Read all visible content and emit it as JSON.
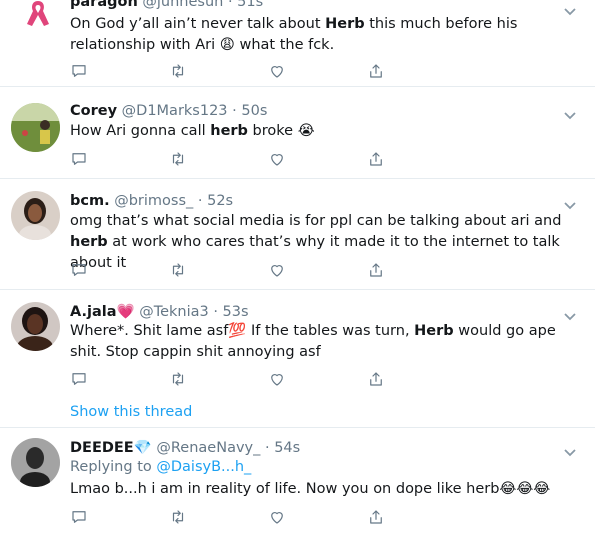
{
  "tweets": [
    {
      "name": "paragon",
      "handle": "@junnesun",
      "time": "· 51s",
      "text_parts": [
        "On God y’all ain’t never talk about ",
        "Herb",
        " this much before his relationship with Ari ",
        "😩",
        " what the fck."
      ]
    },
    {
      "name": "Corey",
      "handle": "@D1Marks123",
      "time": "· 50s",
      "text_parts": [
        "How Ari gonna call ",
        "herb",
        " broke ",
        "😭"
      ]
    },
    {
      "name": "bcm.",
      "handle": "@brimoss_",
      "time": "· 52s",
      "text_parts": [
        "omg that’s what social media is for ppl can be talking about ari and ",
        "herb",
        " at work who cares that’s why it made it to the internet to talk about it"
      ]
    },
    {
      "name": "A.jala",
      "name_emoji": "💗",
      "handle": "@Teknia3",
      "time": "· 53s",
      "text_parts": [
        "Where*. Shit lame asf",
        "💯",
        " If the tables was turn, ",
        "Herb",
        " would go ape shit. Stop cappin shit annoying asf"
      ],
      "show_thread": "Show this thread"
    },
    {
      "name": "DEEDEE",
      "name_emoji": "💎",
      "handle": "@RenaeNavy_",
      "time": "· 54s",
      "replying_label": "Replying to",
      "replying_handle": "@DaisyB...h_",
      "text_parts": [
        "Lmao b...h i am in reality of life. Now you on dope like herb",
        "😂😂😂"
      ]
    }
  ],
  "icons": {
    "reply": "reply-icon",
    "retweet": "retweet-icon",
    "like": "heart-icon",
    "share": "share-icon",
    "more": "chevron-down-icon",
    "ribbon": "pink-ribbon-icon"
  },
  "colors": {
    "link": "#1da1f2",
    "muted": "#657786",
    "text": "#14171a",
    "divider": "#e6ecf0"
  }
}
